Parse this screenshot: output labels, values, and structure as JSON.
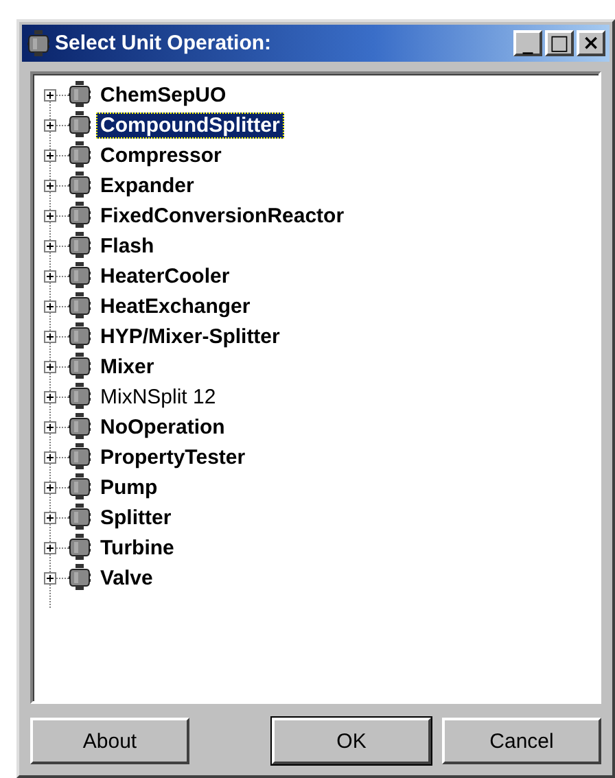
{
  "window": {
    "title": "Select Unit Operation:",
    "controls": [
      "_",
      "□",
      "×"
    ]
  },
  "tree": {
    "items": [
      {
        "label": "ChemSepUO",
        "bold": true,
        "selected": false,
        "expanded": false
      },
      {
        "label": "CompoundSplitter",
        "bold": true,
        "selected": true,
        "expanded": false
      },
      {
        "label": "Compressor",
        "bold": true,
        "selected": false,
        "expanded": false
      },
      {
        "label": "Expander",
        "bold": true,
        "selected": false,
        "expanded": false
      },
      {
        "label": "FixedConversionReactor",
        "bold": true,
        "selected": false,
        "expanded": false
      },
      {
        "label": "Flash",
        "bold": true,
        "selected": false,
        "expanded": false
      },
      {
        "label": "HeaterCooler",
        "bold": true,
        "selected": false,
        "expanded": false
      },
      {
        "label": "HeatExchanger",
        "bold": true,
        "selected": false,
        "expanded": false
      },
      {
        "label": "HYP/Mixer-Splitter",
        "bold": true,
        "selected": false,
        "expanded": false
      },
      {
        "label": "Mixer",
        "bold": true,
        "selected": false,
        "expanded": false
      },
      {
        "label": "MixNSplit 12",
        "bold": false,
        "selected": false,
        "expanded": false
      },
      {
        "label": "NoOperation",
        "bold": true,
        "selected": false,
        "expanded": false
      },
      {
        "label": "PropertyTester",
        "bold": true,
        "selected": false,
        "expanded": false
      },
      {
        "label": "Pump",
        "bold": true,
        "selected": false,
        "expanded": false
      },
      {
        "label": "Splitter",
        "bold": true,
        "selected": false,
        "expanded": false
      },
      {
        "label": "Turbine",
        "bold": true,
        "selected": false,
        "expanded": false
      },
      {
        "label": "Valve",
        "bold": true,
        "selected": false,
        "expanded": false
      }
    ]
  },
  "buttons": [
    {
      "label": "About",
      "default": false
    },
    {
      "label": "OK",
      "default": true
    },
    {
      "label": "Cancel",
      "default": false
    }
  ]
}
